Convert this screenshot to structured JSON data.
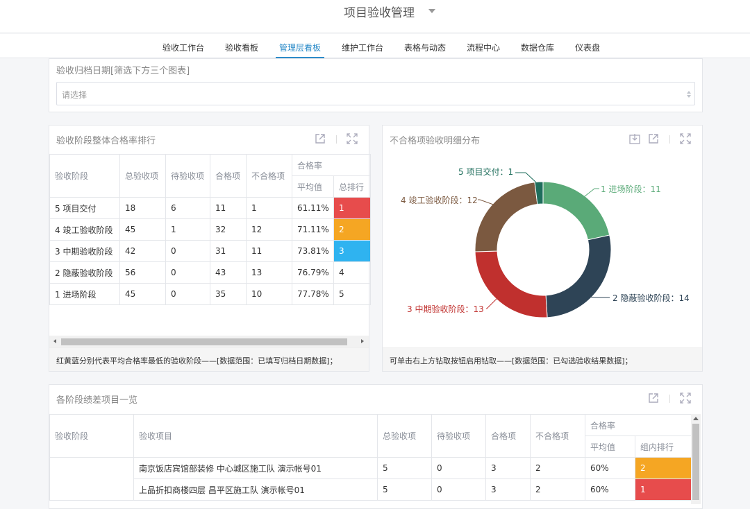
{
  "app": {
    "title": "项目验收管理"
  },
  "nav": {
    "items": [
      "验收工作台",
      "验收看板",
      "管理层看板",
      "维护工作台",
      "表格与动态",
      "流程中心",
      "数据仓库",
      "仪表盘"
    ],
    "active": "管理层看板"
  },
  "filter": {
    "label": "验收归档日期[筛选下方三个图表]",
    "placeholder": "请选择"
  },
  "ranking": {
    "title": "验收阶段整体合格率排行",
    "headers": {
      "stage": "验收阶段",
      "total": "总验收项",
      "pending": "待验收项",
      "pass": "合格项",
      "fail": "不合格项",
      "rate": "合格率",
      "avg": "平均值",
      "rank": "总排行"
    },
    "rows": [
      {
        "stage": "5 项目交付",
        "total": "18",
        "pending": "6",
        "pass": "11",
        "fail": "1",
        "avg": "61.11%",
        "rank": "1"
      },
      {
        "stage": "4 竣工验收阶段",
        "total": "45",
        "pending": "1",
        "pass": "32",
        "fail": "12",
        "avg": "71.11%",
        "rank": "2"
      },
      {
        "stage": "3 中期验收阶段",
        "total": "42",
        "pending": "0",
        "pass": "31",
        "fail": "11",
        "avg": "73.81%",
        "rank": "3"
      },
      {
        "stage": "2 隐蔽验收阶段",
        "total": "56",
        "pending": "0",
        "pass": "43",
        "fail": "13",
        "avg": "76.79%",
        "rank": "4"
      },
      {
        "stage": "1 进场阶段",
        "total": "45",
        "pending": "0",
        "pass": "35",
        "fail": "10",
        "avg": "77.78%",
        "rank": "5"
      }
    ],
    "footer": "红黄蓝分别代表平均合格率最低的验收阶段——[数据范围：已填写归档日期数据]；",
    "rank_colors": {
      "1": "#e74c4c",
      "2": "#f5a623",
      "3": "#2fb3f0"
    }
  },
  "donut": {
    "title": "不合格项验收明细分布",
    "footer": "可单击右上方钻取按钮启用钻取——[数据范围：已勾选验收结果数据]；",
    "labels": [
      "1 进场阶段：11",
      "2 隐蔽验收阶段：14",
      "3 中期验收阶段：13",
      "4 竣工验收阶段：12",
      "5 项目交付：1"
    ]
  },
  "chart_data": {
    "type": "pie",
    "donut": true,
    "categories": [
      "1 进场阶段",
      "2 隐蔽验收阶段",
      "3 中期验收阶段",
      "4 竣工验收阶段",
      "5 项目交付"
    ],
    "values": [
      11,
      14,
      13,
      12,
      1
    ],
    "colors": [
      "#5aaa78",
      "#2e4456",
      "#c0302e",
      "#7b5940",
      "#1f6e5c"
    ]
  },
  "poor": {
    "title": "各阶段绩差项目一览",
    "headers": {
      "stage": "验收阶段",
      "project": "验收项目",
      "total": "总验收项",
      "pending": "待验收项",
      "pass": "合格项",
      "fail": "不合格项",
      "rate": "合格率",
      "avg": "平均值",
      "rank": "组内排行"
    },
    "rows": [
      {
        "stage": "",
        "project": "南京饭店宾馆部装修 中心城区施工队 演示帐号01",
        "total": "5",
        "pending": "0",
        "pass": "3",
        "fail": "2",
        "avg": "60%",
        "rank": "2"
      },
      {
        "stage": "",
        "project": "上品折扣商楼四层 昌平区施工队 演示帐号01",
        "total": "5",
        "pending": "0",
        "pass": "3",
        "fail": "2",
        "avg": "60%",
        "rank": "1"
      }
    ]
  }
}
